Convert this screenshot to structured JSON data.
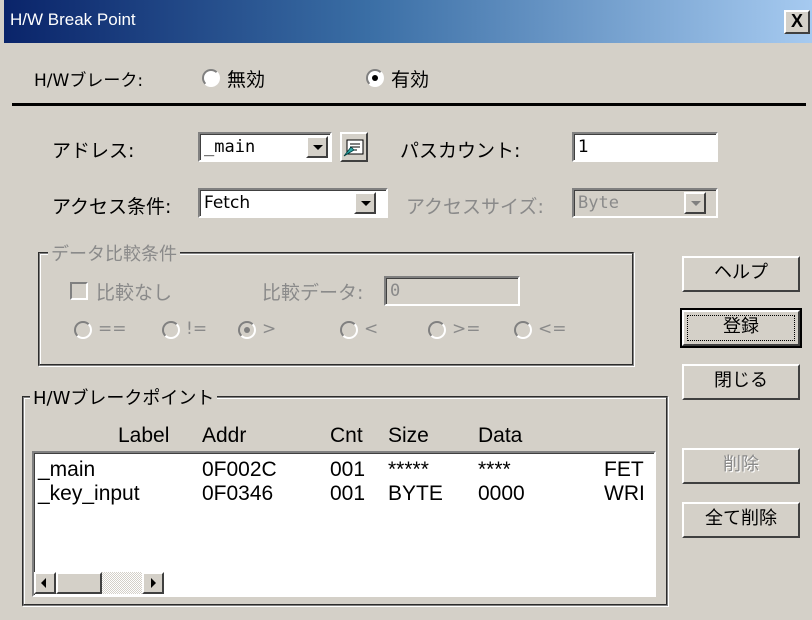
{
  "window": {
    "title": "H/W Break Point",
    "close_glyph": "X"
  },
  "hw_break": {
    "label": "H/Wブレーク:",
    "options": [
      {
        "label": "無効",
        "selected": false
      },
      {
        "label": "有効",
        "selected": true
      }
    ]
  },
  "address": {
    "label": "アドレス:",
    "value": "_main",
    "browse_icon": "symbol-browse-icon"
  },
  "pass_count": {
    "label": "パスカウント:",
    "value": "1"
  },
  "access_condition": {
    "label": "アクセス条件:",
    "value": "Fetch"
  },
  "access_size": {
    "label": "アクセスサイズ:",
    "value": "Byte",
    "enabled": false
  },
  "data_compare": {
    "title": "データ比較条件",
    "no_compare_label": "比較なし",
    "no_compare_checked": false,
    "compare_data_label": "比較データ:",
    "compare_data_value": "0",
    "operators": [
      {
        "label": "==",
        "selected": false
      },
      {
        "label": "!=",
        "selected": false
      },
      {
        "label": ">",
        "selected": true
      },
      {
        "label": "<",
        "selected": false
      },
      {
        "label": ">=",
        "selected": false
      },
      {
        "label": "<=",
        "selected": false
      }
    ]
  },
  "buttons": {
    "help": "ヘルプ",
    "register": "登録",
    "close": "閉じる",
    "delete": "削除",
    "delete_all": "全て削除"
  },
  "breakpoint_list": {
    "title": "H/Wブレークポイント",
    "columns": [
      "Label",
      "Addr",
      "Cnt",
      "Size",
      "Data"
    ],
    "rows": [
      {
        "label": "_main",
        "addr": "0F002C",
        "cnt": "001",
        "size": "*****",
        "data": "****",
        "type": "FET"
      },
      {
        "label": "_key_input",
        "addr": "0F0346",
        "cnt": "001",
        "size": "BYTE",
        "data": "0000",
        "type": "WRI"
      }
    ]
  }
}
